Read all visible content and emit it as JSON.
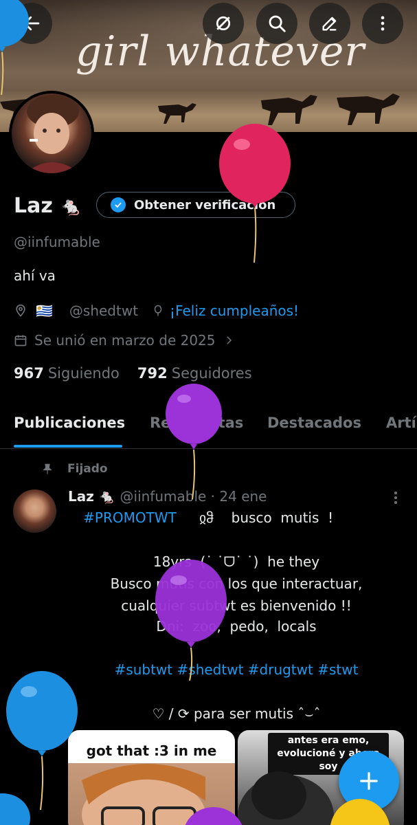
{
  "banner": {
    "title": "girl whatever"
  },
  "header_buttons": [
    "back-arrow-icon",
    "filter-icon",
    "search-icon",
    "edit-icon",
    "more-icon"
  ],
  "profile": {
    "name": "Laz",
    "name_emoji": "🐁",
    "verify_label": "Obtener verificación",
    "handle": "@iinfumable",
    "bio": "ahí va",
    "flag": "🇺🇾",
    "website": "@shedtwt",
    "birthday": "¡Feliz cumpleaños!",
    "joined": "Se unió en marzo de 2025",
    "following_count": "967",
    "following_label": "Siguiendo",
    "followers_count": "792",
    "followers_label": "Seguidores"
  },
  "tabs": [
    "Publicaciones",
    "Respuestas",
    "Destacados",
    "Artí"
  ],
  "post": {
    "pinned_label": "Fijado",
    "author": "Laz",
    "author_emoji": "🐁",
    "handle_time": "@iinfumable · 24 ene",
    "lines": [
      "#PROMOTWT",
      "ჲჵ    busco  mutis  !",
      "18yrs  (˙ ˙ᗜ˙ ˙)  he they",
      "Busco mutis con los que interactuar,",
      "cualquier subtwt es bienvenido !!",
      "Dni:  zoo,  pedo,  locals",
      "#subtwt #shedtwt #drugtwt #stwt",
      "♡ / ⟳ para ser mutis ˆ⌣ˆ"
    ],
    "media": [
      {
        "caption": "got that :3 in me"
      },
      {
        "caption": "antes era emo, evolucioné y ahora soy"
      }
    ]
  },
  "colors": {
    "accent": "#1d9bf0",
    "muted": "#71767b",
    "text": "#e7e9ea",
    "background": "#000000"
  }
}
